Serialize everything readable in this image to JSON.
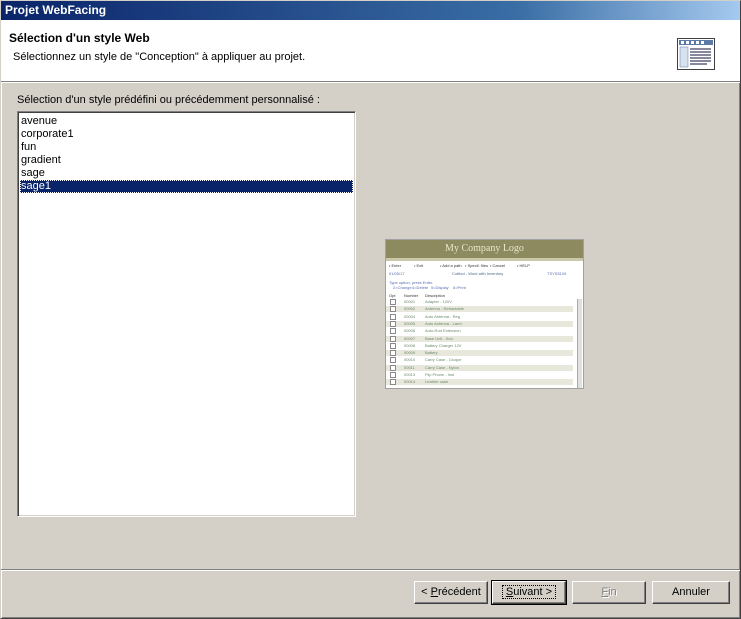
{
  "window": {
    "title": "Projet WebFacing"
  },
  "header": {
    "title": "Sélection d'un style Web",
    "description": "Sélectionnez un style de \"Conception\" à appliquer au projet.",
    "icon": "wizard-page-icon"
  },
  "style_list": {
    "label": "Sélection d'un style prédéfini ou précédemment personnalisé :",
    "items": [
      {
        "label": "avenue",
        "selected": false
      },
      {
        "label": "corporate1",
        "selected": false
      },
      {
        "label": "fun",
        "selected": false
      },
      {
        "label": "gradient",
        "selected": false
      },
      {
        "label": "sage",
        "selected": false
      },
      {
        "label": "sage1",
        "selected": true
      }
    ],
    "selected_value": "sage1"
  },
  "preview": {
    "logo_text": "My Company Logo",
    "menu": [
      "Enter",
      "Exit",
      "Add a path",
      "Specif. files",
      "Cancel",
      "HELP"
    ],
    "date": "01/05/17",
    "screen_title": "Cottbol - Work with Inventory",
    "system": "TSYS5109",
    "instructions": "Type option, press Enter.",
    "options": [
      "2=Change",
      "4=Delete",
      "5=Display",
      "6=Print"
    ],
    "columns": [
      "Opt",
      "Number",
      "Description"
    ],
    "rows": [
      {
        "number": "00001",
        "description": "Adapter - 120V"
      },
      {
        "number": "00002",
        "description": "Antenna - Retractable"
      },
      {
        "number": "00004",
        "description": "Auto Antenna - Reg"
      },
      {
        "number": "00005",
        "description": "Auto Antenna - Larm"
      },
      {
        "number": "00006",
        "description": "Auto-Rod Extension"
      },
      {
        "number": "00007",
        "description": "Base Unit - 9v/c"
      },
      {
        "number": "00008",
        "description": "Battery Charger 12V"
      },
      {
        "number": "00009",
        "description": "Battery"
      },
      {
        "number": "00010",
        "description": "Carry Case - Cloque"
      },
      {
        "number": "00011",
        "description": "Carry Case - Nylon"
      },
      {
        "number": "00013",
        "description": "Flip Phone - Inst"
      },
      {
        "number": "00014",
        "description": "Leather case"
      }
    ],
    "colors": {
      "logo_band": "#8c8a5e",
      "row_alt": "#e8e7dc",
      "link": "#5a6fb0"
    }
  },
  "buttons": {
    "back": {
      "label": "Précédent",
      "mnemonic_prefix": "< ",
      "enabled": true
    },
    "next": {
      "label": "Suivant",
      "suffix": " >",
      "enabled": true,
      "default": true
    },
    "finish": {
      "label": "Fin",
      "enabled": false
    },
    "cancel": {
      "label": "Annuler",
      "enabled": true
    }
  },
  "colors": {
    "title_bar": "#0a246a",
    "selection": "#0a246a",
    "dialog_bg": "#d4d0c8"
  }
}
